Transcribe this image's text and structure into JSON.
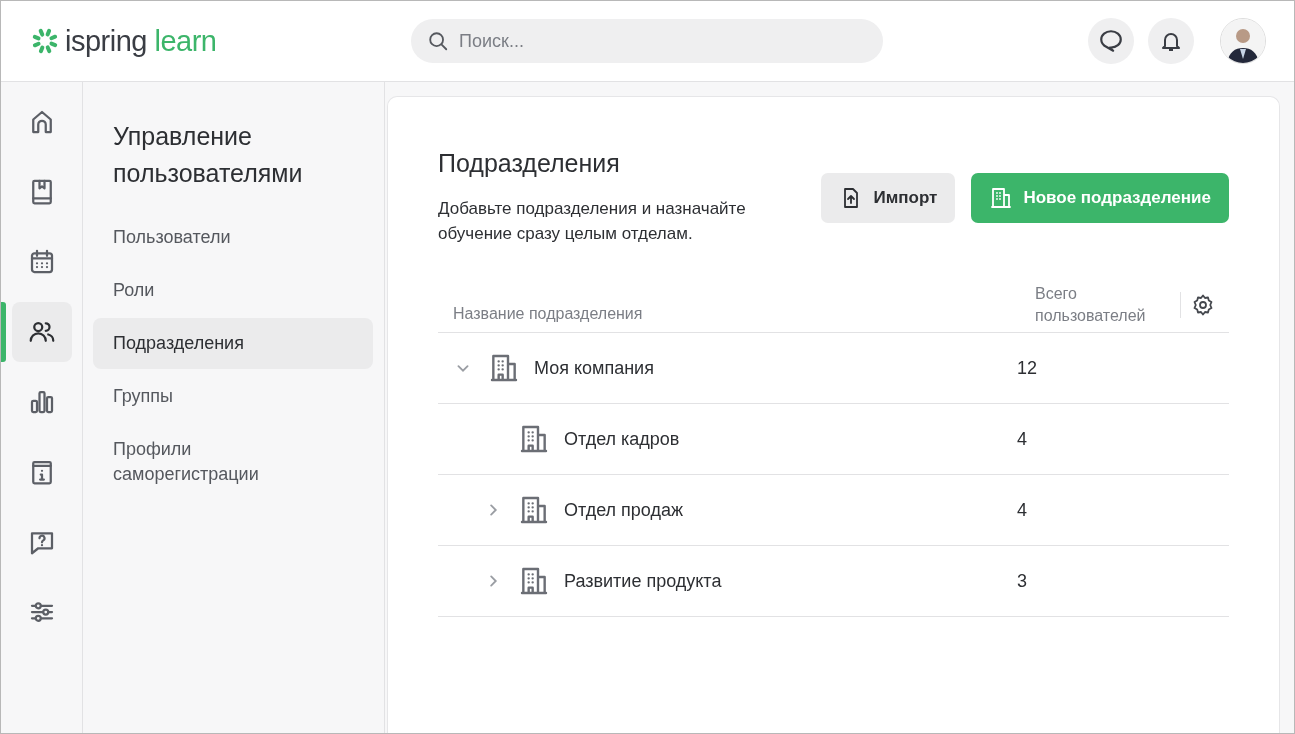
{
  "header": {
    "logo": {
      "brand": "ispring",
      "product": "learn"
    },
    "search": {
      "placeholder": "Поиск..."
    }
  },
  "rail": [
    {
      "selected": false
    },
    {
      "selected": false
    },
    {
      "selected": false
    },
    {
      "selected": true
    },
    {
      "selected": false
    },
    {
      "selected": false
    },
    {
      "selected": false
    },
    {
      "selected": false
    }
  ],
  "sidebar": {
    "title": "Управление пользователями",
    "items": [
      {
        "label": "Пользователи",
        "selected": false
      },
      {
        "label": "Роли",
        "selected": false
      },
      {
        "label": "Подразделения",
        "selected": true
      },
      {
        "label": "Группы",
        "selected": false
      },
      {
        "label": "Профили саморегистрации",
        "selected": false
      }
    ]
  },
  "content": {
    "title": "Подразделения",
    "description": "Добавьте подразделения и назначайте обучение сразу целым отделам.",
    "buttons": [
      {
        "label": "Импорт",
        "kind": "secondary"
      },
      {
        "label": "Новое подразделение",
        "kind": "primary"
      }
    ],
    "table": {
      "columns": [
        "Название подразделения",
        "Всего пользователей"
      ],
      "rows": [
        {
          "name": "Моя компания",
          "count": "12",
          "expanded": true,
          "children": [
            {
              "name": "Отдел кадров",
              "count": "4"
            },
            {
              "name": "Отдел продаж",
              "count": "4",
              "expanded": false
            },
            {
              "name": "Развитие продукта",
              "count": "3",
              "expanded": false
            }
          ]
        }
      ]
    }
  }
}
